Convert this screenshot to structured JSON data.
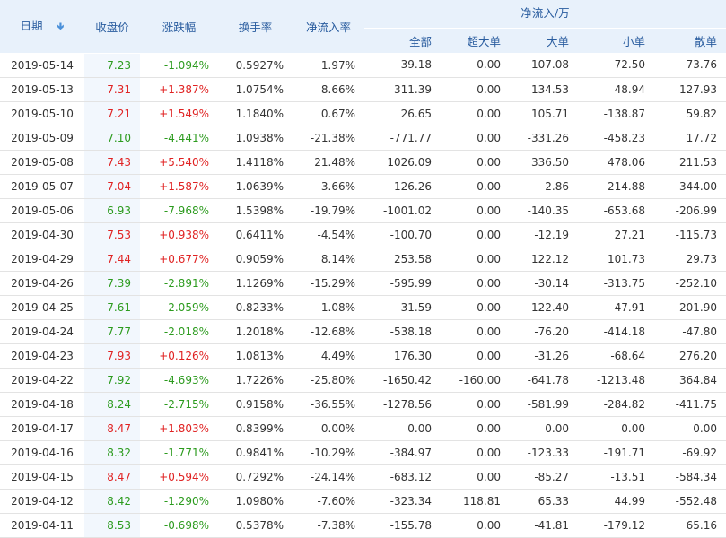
{
  "headers": {
    "date": "日期",
    "close": "收盘价",
    "change": "涨跌幅",
    "turnover": "换手率",
    "net_inflow_rate": "净流入率",
    "net_inflow_group": "净流入/万",
    "all": "全部",
    "super_large": "超大单",
    "large": "大单",
    "small": "小单",
    "retail": "散单"
  },
  "colors": {
    "up": "#e02222",
    "down": "#2c9b1e",
    "header_bg": "#e8f1fb",
    "header_text": "#2a5d9f"
  },
  "rows": [
    {
      "date": "2019-05-14",
      "close": "7.23",
      "change": "-1.094%",
      "turnover": "0.5927%",
      "rate": "1.97%",
      "all": "39.18",
      "super": "0.00",
      "large": "-107.08",
      "small": "72.50",
      "retail": "73.76",
      "dir": "down"
    },
    {
      "date": "2019-05-13",
      "close": "7.31",
      "change": "+1.387%",
      "turnover": "1.0754%",
      "rate": "8.66%",
      "all": "311.39",
      "super": "0.00",
      "large": "134.53",
      "small": "48.94",
      "retail": "127.93",
      "dir": "up"
    },
    {
      "date": "2019-05-10",
      "close": "7.21",
      "change": "+1.549%",
      "turnover": "1.1840%",
      "rate": "0.67%",
      "all": "26.65",
      "super": "0.00",
      "large": "105.71",
      "small": "-138.87",
      "retail": "59.82",
      "dir": "up"
    },
    {
      "date": "2019-05-09",
      "close": "7.10",
      "change": "-4.441%",
      "turnover": "1.0938%",
      "rate": "-21.38%",
      "all": "-771.77",
      "super": "0.00",
      "large": "-331.26",
      "small": "-458.23",
      "retail": "17.72",
      "dir": "down"
    },
    {
      "date": "2019-05-08",
      "close": "7.43",
      "change": "+5.540%",
      "turnover": "1.4118%",
      "rate": "21.48%",
      "all": "1026.09",
      "super": "0.00",
      "large": "336.50",
      "small": "478.06",
      "retail": "211.53",
      "dir": "up"
    },
    {
      "date": "2019-05-07",
      "close": "7.04",
      "change": "+1.587%",
      "turnover": "1.0639%",
      "rate": "3.66%",
      "all": "126.26",
      "super": "0.00",
      "large": "-2.86",
      "small": "-214.88",
      "retail": "344.00",
      "dir": "up"
    },
    {
      "date": "2019-05-06",
      "close": "6.93",
      "change": "-7.968%",
      "turnover": "1.5398%",
      "rate": "-19.79%",
      "all": "-1001.02",
      "super": "0.00",
      "large": "-140.35",
      "small": "-653.68",
      "retail": "-206.99",
      "dir": "down"
    },
    {
      "date": "2019-04-30",
      "close": "7.53",
      "change": "+0.938%",
      "turnover": "0.6411%",
      "rate": "-4.54%",
      "all": "-100.70",
      "super": "0.00",
      "large": "-12.19",
      "small": "27.21",
      "retail": "-115.73",
      "dir": "up"
    },
    {
      "date": "2019-04-29",
      "close": "7.44",
      "change": "+0.677%",
      "turnover": "0.9059%",
      "rate": "8.14%",
      "all": "253.58",
      "super": "0.00",
      "large": "122.12",
      "small": "101.73",
      "retail": "29.73",
      "dir": "up"
    },
    {
      "date": "2019-04-26",
      "close": "7.39",
      "change": "-2.891%",
      "turnover": "1.1269%",
      "rate": "-15.29%",
      "all": "-595.99",
      "super": "0.00",
      "large": "-30.14",
      "small": "-313.75",
      "retail": "-252.10",
      "dir": "down"
    },
    {
      "date": "2019-04-25",
      "close": "7.61",
      "change": "-2.059%",
      "turnover": "0.8233%",
      "rate": "-1.08%",
      "all": "-31.59",
      "super": "0.00",
      "large": "122.40",
      "small": "47.91",
      "retail": "-201.90",
      "dir": "down"
    },
    {
      "date": "2019-04-24",
      "close": "7.77",
      "change": "-2.018%",
      "turnover": "1.2018%",
      "rate": "-12.68%",
      "all": "-538.18",
      "super": "0.00",
      "large": "-76.20",
      "small": "-414.18",
      "retail": "-47.80",
      "dir": "down"
    },
    {
      "date": "2019-04-23",
      "close": "7.93",
      "change": "+0.126%",
      "turnover": "1.0813%",
      "rate": "4.49%",
      "all": "176.30",
      "super": "0.00",
      "large": "-31.26",
      "small": "-68.64",
      "retail": "276.20",
      "dir": "up"
    },
    {
      "date": "2019-04-22",
      "close": "7.92",
      "change": "-4.693%",
      "turnover": "1.7226%",
      "rate": "-25.80%",
      "all": "-1650.42",
      "super": "-160.00",
      "large": "-641.78",
      "small": "-1213.48",
      "retail": "364.84",
      "dir": "down"
    },
    {
      "date": "2019-04-18",
      "close": "8.24",
      "change": "-2.715%",
      "turnover": "0.9158%",
      "rate": "-36.55%",
      "all": "-1278.56",
      "super": "0.00",
      "large": "-581.99",
      "small": "-284.82",
      "retail": "-411.75",
      "dir": "down"
    },
    {
      "date": "2019-04-17",
      "close": "8.47",
      "change": "+1.803%",
      "turnover": "0.8399%",
      "rate": "0.00%",
      "all": "0.00",
      "super": "0.00",
      "large": "0.00",
      "small": "0.00",
      "retail": "0.00",
      "dir": "up"
    },
    {
      "date": "2019-04-16",
      "close": "8.32",
      "change": "-1.771%",
      "turnover": "0.9841%",
      "rate": "-10.29%",
      "all": "-384.97",
      "super": "0.00",
      "large": "-123.33",
      "small": "-191.71",
      "retail": "-69.92",
      "dir": "down"
    },
    {
      "date": "2019-04-15",
      "close": "8.47",
      "change": "+0.594%",
      "turnover": "0.7292%",
      "rate": "-24.14%",
      "all": "-683.12",
      "super": "0.00",
      "large": "-85.27",
      "small": "-13.51",
      "retail": "-584.34",
      "dir": "up"
    },
    {
      "date": "2019-04-12",
      "close": "8.42",
      "change": "-1.290%",
      "turnover": "1.0980%",
      "rate": "-7.60%",
      "all": "-323.34",
      "super": "118.81",
      "large": "65.33",
      "small": "44.99",
      "retail": "-552.48",
      "dir": "down"
    },
    {
      "date": "2019-04-11",
      "close": "8.53",
      "change": "-0.698%",
      "turnover": "0.5378%",
      "rate": "-7.38%",
      "all": "-155.78",
      "super": "0.00",
      "large": "-41.81",
      "small": "-179.12",
      "retail": "65.16",
      "dir": "down"
    }
  ]
}
